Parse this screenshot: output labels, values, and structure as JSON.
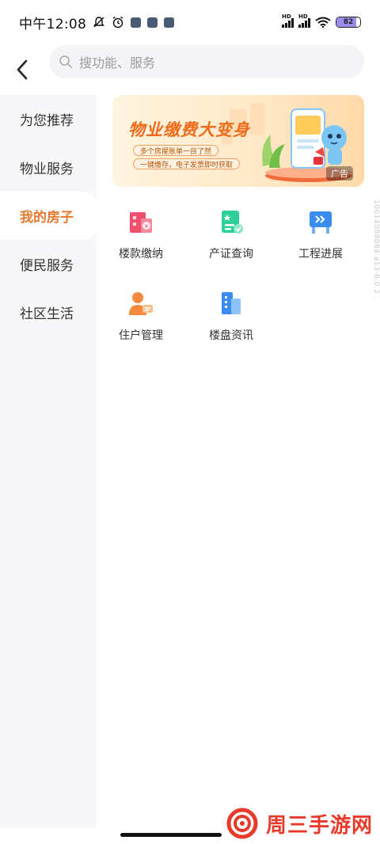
{
  "status_bar": {
    "time": "中午12:08",
    "battery": "82",
    "hd1": "HD",
    "hd2": "HD"
  },
  "header": {
    "back_icon": "back-arrow-icon",
    "search_placeholder": "搜功能、服务"
  },
  "sidebar": {
    "items": [
      {
        "label": "为您推荐"
      },
      {
        "label": "物业服务"
      },
      {
        "label": "我的房子"
      },
      {
        "label": "便民服务"
      },
      {
        "label": "社区生活"
      }
    ],
    "active_index": 2
  },
  "banner": {
    "title": "物业缴费大变身",
    "line1": "多个房屋账单一目了然",
    "line2": "一键缴存，电子发票即时获取",
    "tag": "广告"
  },
  "grid": {
    "items": [
      {
        "label": "楼款缴纳",
        "icon": "building-payment-icon",
        "color": "#f0506e"
      },
      {
        "label": "产证查询",
        "icon": "certificate-icon",
        "color": "#2fcf9b"
      },
      {
        "label": "工程进展",
        "icon": "progress-board-icon",
        "color": "#3a8cf0"
      },
      {
        "label": "住户管理",
        "icon": "resident-icon",
        "color": "#f58a3c"
      },
      {
        "label": "楼盘资讯",
        "icon": "building-info-icon",
        "color": "#3a8cf0"
      }
    ]
  },
  "side_code": "10014088084.a13-6.0.2",
  "watermark": {
    "text": "周三手游网"
  },
  "colors": {
    "accent": "#e8782c",
    "sidebar_bg": "#f7f7f9"
  }
}
